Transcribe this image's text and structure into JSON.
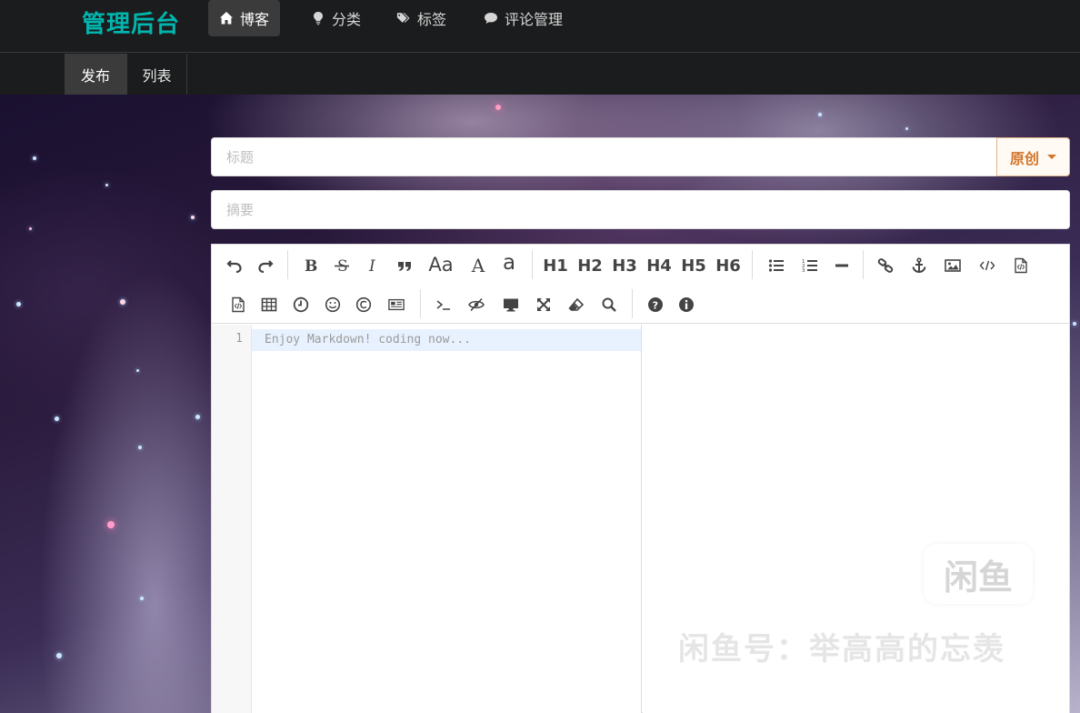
{
  "brand": "管理后台",
  "nav": [
    {
      "label": "博客",
      "icon": "home-icon",
      "active": true
    },
    {
      "label": "分类",
      "icon": "lightbulb-icon",
      "active": false
    },
    {
      "label": "标签",
      "icon": "tags-icon",
      "active": false
    },
    {
      "label": "评论管理",
      "icon": "comment-icon",
      "active": false
    }
  ],
  "subnav": [
    {
      "label": "发布",
      "active": true
    },
    {
      "label": "列表",
      "active": false
    }
  ],
  "form": {
    "title_placeholder": "标题",
    "summary_placeholder": "摘要",
    "type_selected": "原创"
  },
  "toolbar": {
    "row1": [
      "undo-icon",
      "redo-icon",
      "|",
      "bold-icon",
      "strikethrough-icon",
      "italic-icon",
      "quote-icon",
      "uppercase-icon",
      "title-case-icon",
      "lowercase-icon",
      "|",
      "H1",
      "H2",
      "H3",
      "H4",
      "H5",
      "H6",
      "|",
      "unordered-list-icon",
      "ordered-list-icon",
      "horizontal-rule-icon",
      "|",
      "link-icon",
      "anchor-icon",
      "image-icon",
      "code-icon",
      "preformatted-code-icon"
    ],
    "row2": [
      "code-block-icon",
      "table-icon",
      "datetime-icon",
      "emoji-icon",
      "html-entities-icon",
      "pagebreak-icon",
      "|",
      "goto-line-icon",
      "watch-icon",
      "preview-icon",
      "fullscreen-icon",
      "clear-icon",
      "search-icon",
      "|",
      "help-icon",
      "info-icon"
    ],
    "text_buttons": {
      "uppercase": "Aa",
      "titlecase": "A",
      "lowercase": "a",
      "h1": "H1",
      "h2": "H2",
      "h3": "H3",
      "h4": "H4",
      "h5": "H5",
      "h6": "H6"
    }
  },
  "editor": {
    "line_number": "1",
    "placeholder": "Enjoy Markdown! coding now..."
  },
  "watermark": {
    "logo_text": "闲鱼",
    "text": "闲鱼号：举高高的忘羡"
  },
  "colors": {
    "brand": "#00b5ad",
    "dropdown_accent": "#d2742a",
    "active_line": "#e8f2fe"
  }
}
